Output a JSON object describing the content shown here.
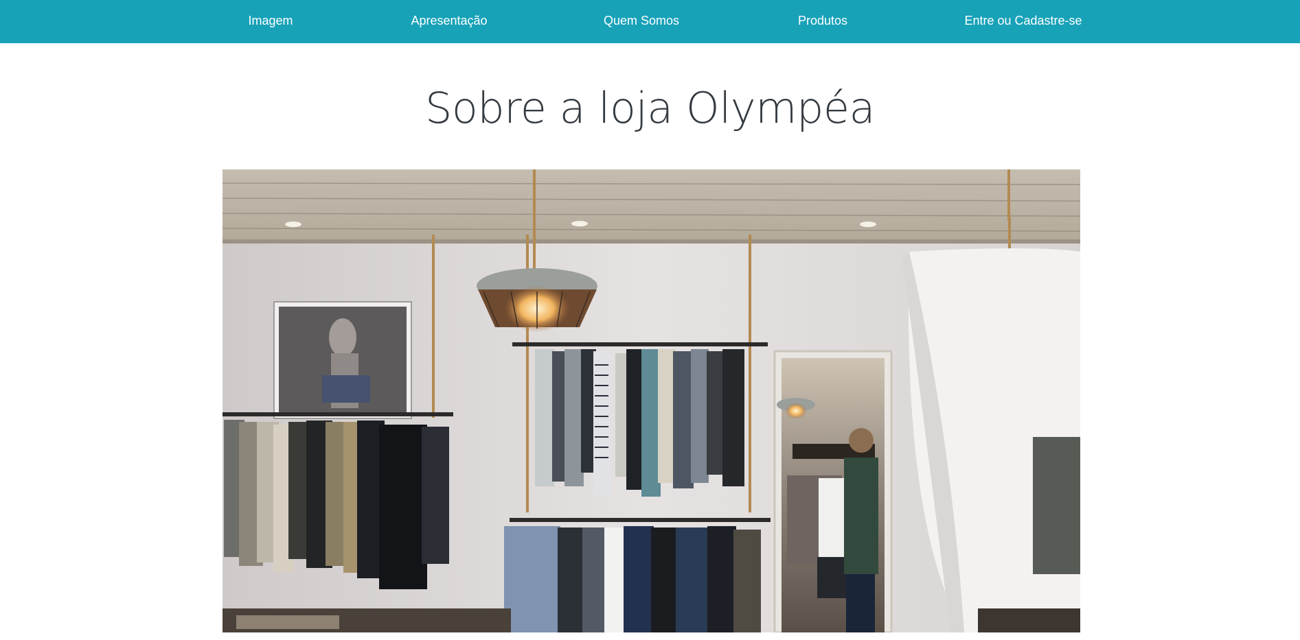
{
  "nav": {
    "items": [
      {
        "label": "Imagem"
      },
      {
        "label": "Apresentação"
      },
      {
        "label": "Quem Somos"
      },
      {
        "label": "Produtos"
      },
      {
        "label": "Entre ou Cadastre-se"
      }
    ]
  },
  "main": {
    "title": "Sobre a loja Olympéa"
  },
  "colors": {
    "navbar": "#17a2b8",
    "nav_text": "#ffffff",
    "title_text": "#343a40",
    "background": "#ffffff"
  }
}
